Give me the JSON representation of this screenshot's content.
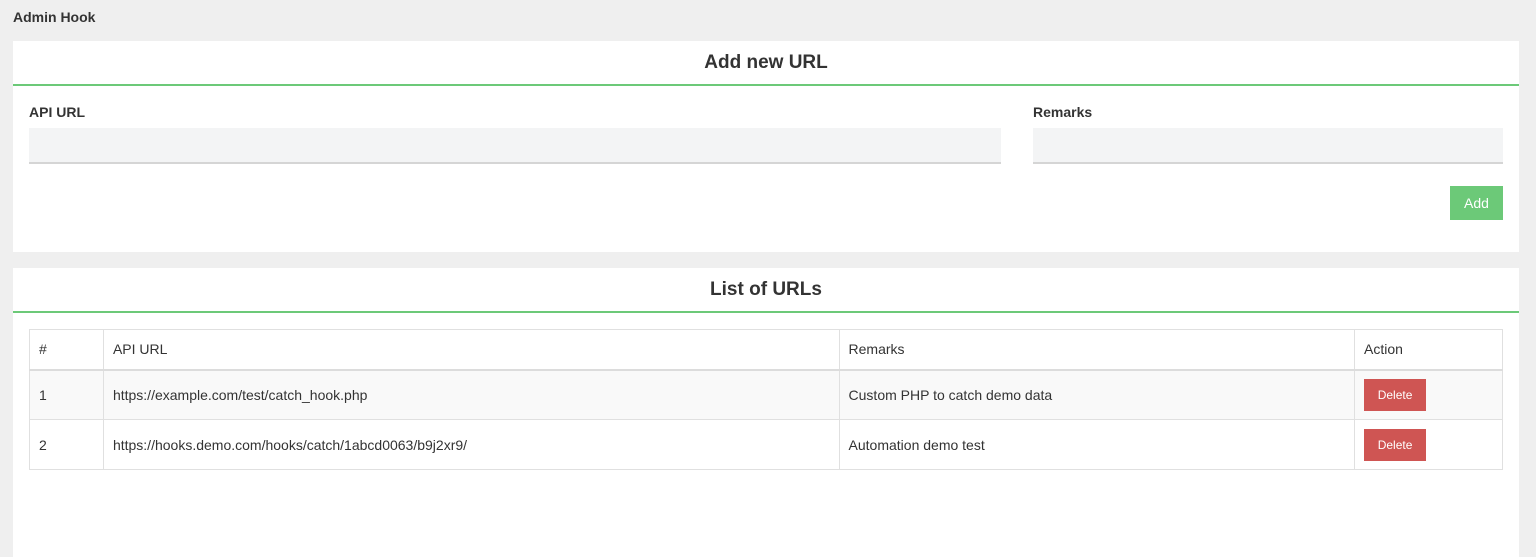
{
  "app": {
    "title": "Admin Hook"
  },
  "add_panel": {
    "heading": "Add new URL",
    "api_url_label": "API URL",
    "api_url_value": "",
    "remarks_label": "Remarks",
    "remarks_value": "",
    "add_button": "Add"
  },
  "list_panel": {
    "heading": "List of URLs",
    "columns": [
      "#",
      "API URL",
      "Remarks",
      "Action"
    ],
    "rows": [
      {
        "num": "1",
        "url": "https://example.com/test/catch_hook.php",
        "remarks": "Custom PHP to catch demo data",
        "action": "Delete"
      },
      {
        "num": "2",
        "url": "https://hooks.demo.com/hooks/catch/1abcd0063/b9j2xr9/",
        "remarks": "Automation demo test",
        "action": "Delete"
      }
    ]
  },
  "colors": {
    "accent_green": "#6cc978",
    "delete_red": "#cf5553",
    "background": "#efefef"
  }
}
